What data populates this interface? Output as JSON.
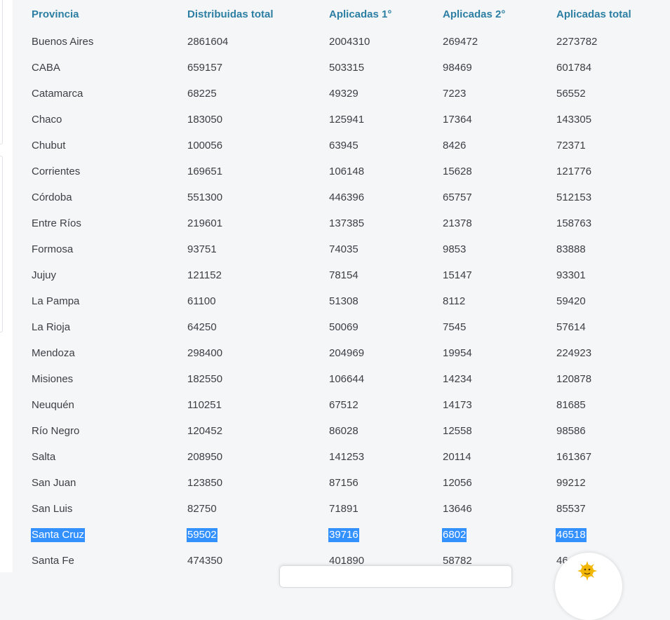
{
  "table": {
    "headers": [
      "Provincia",
      "Distribuidas total",
      "Aplicadas 1°",
      "Aplicadas 2°",
      "Aplicadas total"
    ],
    "rows": [
      [
        "Buenos Aires",
        "2861604",
        "2004310",
        "269472",
        "2273782"
      ],
      [
        "CABA",
        "659157",
        "503315",
        "98469",
        "601784"
      ],
      [
        "Catamarca",
        "68225",
        "49329",
        "7223",
        "56552"
      ],
      [
        "Chaco",
        "183050",
        "125941",
        "17364",
        "143305"
      ],
      [
        "Chubut",
        "100056",
        "63945",
        "8426",
        "72371"
      ],
      [
        "Corrientes",
        "169651",
        "106148",
        "15628",
        "121776"
      ],
      [
        "Córdoba",
        "551300",
        "446396",
        "65757",
        "512153"
      ],
      [
        "Entre Ríos",
        "219601",
        "137385",
        "21378",
        "158763"
      ],
      [
        "Formosa",
        "93751",
        "74035",
        "9853",
        "83888"
      ],
      [
        "Jujuy",
        "121152",
        "78154",
        "15147",
        "93301"
      ],
      [
        "La Pampa",
        "61100",
        "51308",
        "8112",
        "59420"
      ],
      [
        "La Rioja",
        "64250",
        "50069",
        "7545",
        "57614"
      ],
      [
        "Mendoza",
        "298400",
        "204969",
        "19954",
        "224923"
      ],
      [
        "Misiones",
        "182550",
        "106644",
        "14234",
        "120878"
      ],
      [
        "Neuquén",
        "110251",
        "67512",
        "14173",
        "81685"
      ],
      [
        "Río Negro",
        "120452",
        "86028",
        "12558",
        "98586"
      ],
      [
        "Salta",
        "208950",
        "141253",
        "20114",
        "161367"
      ],
      [
        "San Juan",
        "123850",
        "87156",
        "12056",
        "99212"
      ],
      [
        "San Luis",
        "82750",
        "71891",
        "13646",
        "85537"
      ],
      [
        "Santa Cruz",
        "59502",
        "39716",
        "6802",
        "46518"
      ],
      [
        "Santa Fe",
        "474350",
        "401890",
        "58782",
        "46"
      ]
    ],
    "selected_row_index": 19
  },
  "colors": {
    "header_text": "#2c7fa3",
    "body_text": "#3b3f44",
    "selection": "#3390ff",
    "background": "#f5f6f8"
  },
  "widgets": {
    "chat_icon": "sun-face-icon"
  }
}
